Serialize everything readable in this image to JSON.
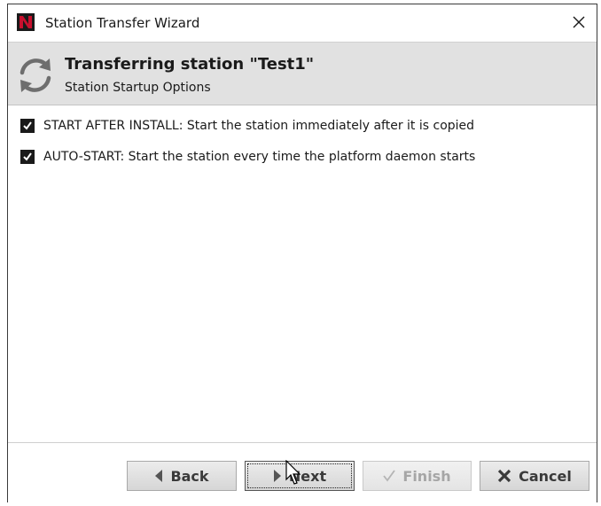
{
  "window": {
    "title": "Station Transfer Wizard",
    "logo_icon": "niagara-n-logo",
    "close_icon": "close-icon",
    "brand_color": "#c8102e"
  },
  "header": {
    "icon": "refresh-cycle-icon",
    "title": "Transferring station \"Test1\"",
    "subtitle": "Station Startup Options"
  },
  "options": [
    {
      "label": "START AFTER INSTALL: Start the station immediately after it is copied",
      "checked": true
    },
    {
      "label": "AUTO-START: Start the station every time the platform daemon starts",
      "checked": true
    }
  ],
  "footer": {
    "back_label": "Back",
    "next_label": "Next",
    "finish_label": "Finish",
    "cancel_label": "Cancel",
    "finish_enabled": false
  }
}
